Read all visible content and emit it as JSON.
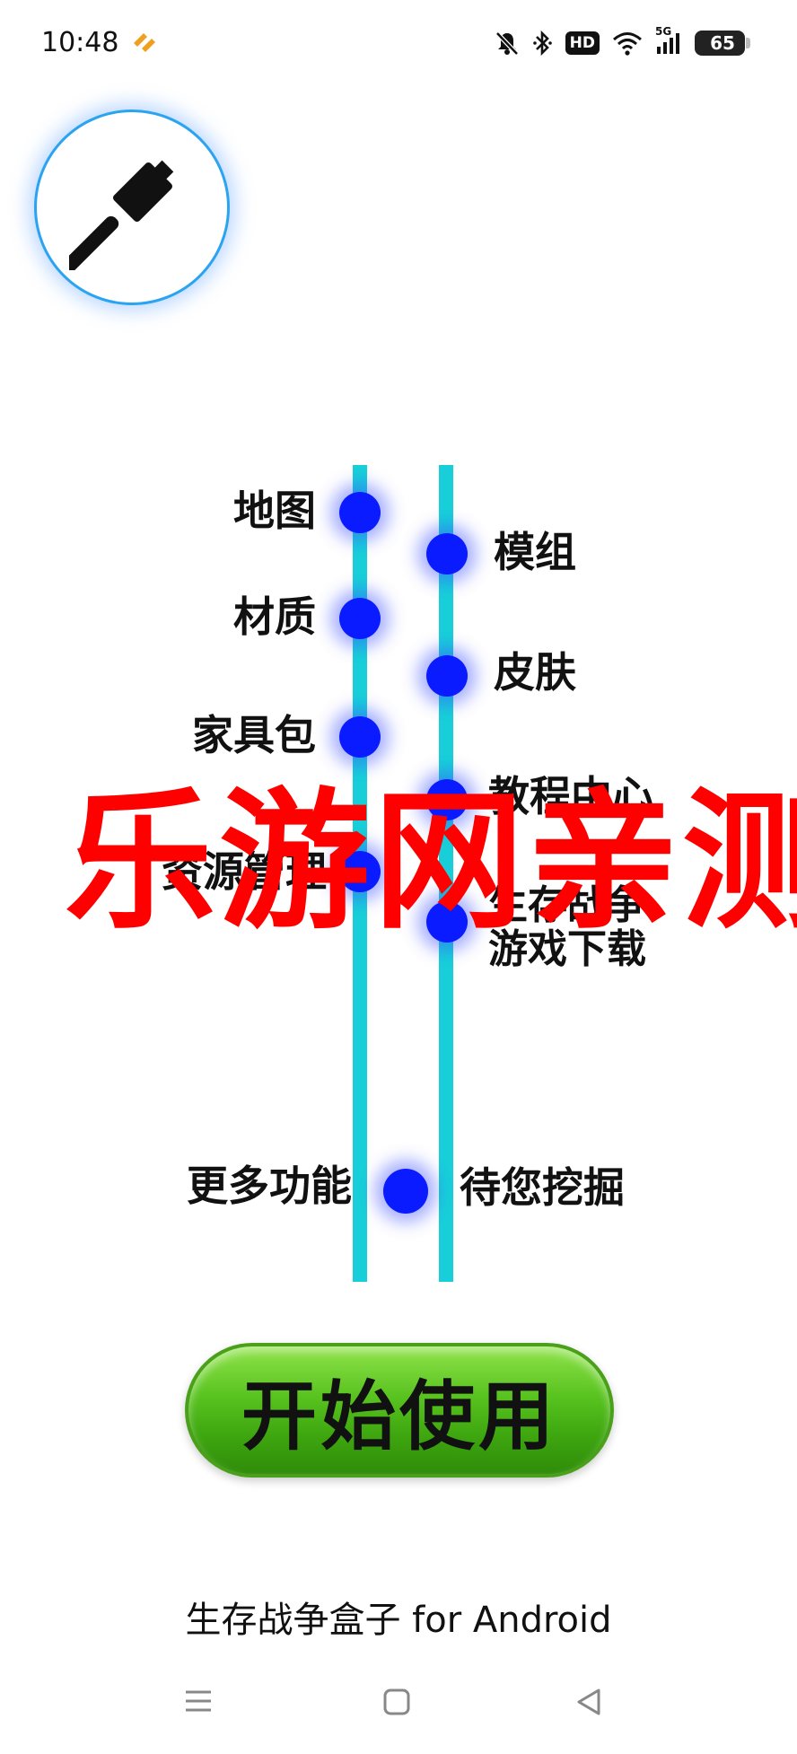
{
  "status_bar": {
    "time": "10:48",
    "icons": [
      "app-notification-icon",
      "mute-bell-icon",
      "bluetooth-icon",
      "hd-icon",
      "wifi-icon",
      "signal-5g-icon",
      "battery-icon"
    ],
    "hd_label": "HD",
    "network": "5G",
    "battery": "65"
  },
  "menu": {
    "left_items": [
      {
        "label": "地图"
      },
      {
        "label": "材质"
      },
      {
        "label": "家具包"
      },
      {
        "label": "资源管理"
      }
    ],
    "right_items": [
      {
        "label": "模组"
      },
      {
        "label": "皮肤"
      },
      {
        "label": "教程中心"
      },
      {
        "label": "生存战争\n游戏下载"
      }
    ],
    "more_left": "更多功能",
    "more_right": "待您挖掘"
  },
  "start_button": {
    "label": "开始使用"
  },
  "footer": {
    "text": "生存战争盒子 for Android"
  },
  "watermark": {
    "text": "乐游网亲测"
  },
  "colors": {
    "line": "#18cfd9",
    "dot": "#0a1bff",
    "button": "#58c21f",
    "watermark": "#ff0000",
    "circle_border": "#2aa4f0"
  }
}
